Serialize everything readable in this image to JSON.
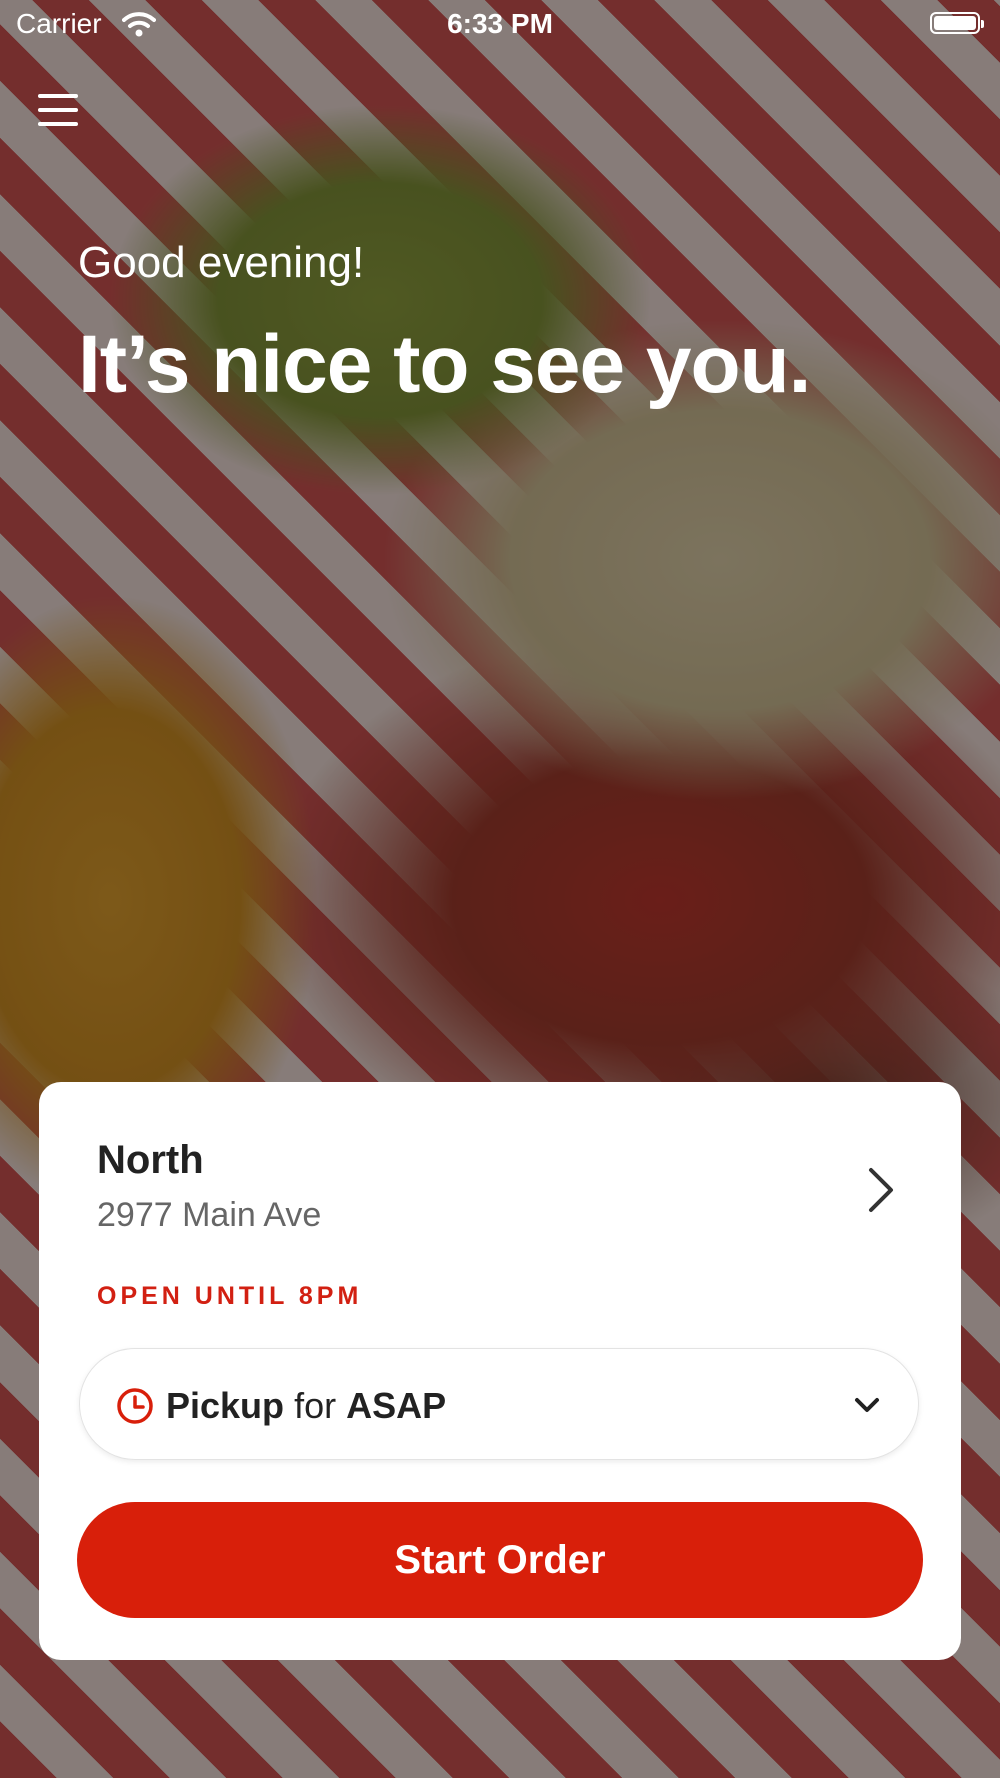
{
  "status_bar": {
    "carrier": "Carrier",
    "time": "6:33 PM"
  },
  "hero": {
    "greeting": "Good evening!",
    "headline": "It’s nice to see you."
  },
  "location_card": {
    "name": "North",
    "address": "2977 Main Ave",
    "status": "OPEN UNTIL 8PM",
    "order_type": "Pickup",
    "connector": "for",
    "order_time": "ASAP",
    "start_label": "Start Order"
  },
  "colors": {
    "accent": "#d81f0a",
    "status_red": "#d22012"
  },
  "icons": [
    "wifi-icon",
    "battery-icon",
    "menu-icon",
    "chevron-right-icon",
    "clock-icon",
    "chevron-down-icon"
  ]
}
